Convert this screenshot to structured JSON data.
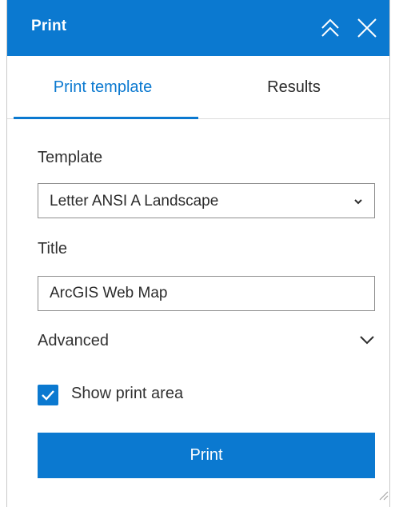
{
  "header": {
    "title": "Print",
    "background_color": "#0b79d0",
    "collapse_icon": "double-chevron-up-icon",
    "close_icon": "close-icon"
  },
  "tabs": [
    {
      "label": "Print template",
      "active": true
    },
    {
      "label": "Results",
      "active": false
    }
  ],
  "form": {
    "template_label": "Template",
    "template_value": "Letter ANSI A Landscape",
    "title_label": "Title",
    "title_value": "ArcGIS Web Map",
    "advanced_label": "Advanced",
    "show_print_area_label": "Show print area",
    "show_print_area_checked": true
  },
  "print_button_label": "Print",
  "accent_color": "#0b79d0"
}
